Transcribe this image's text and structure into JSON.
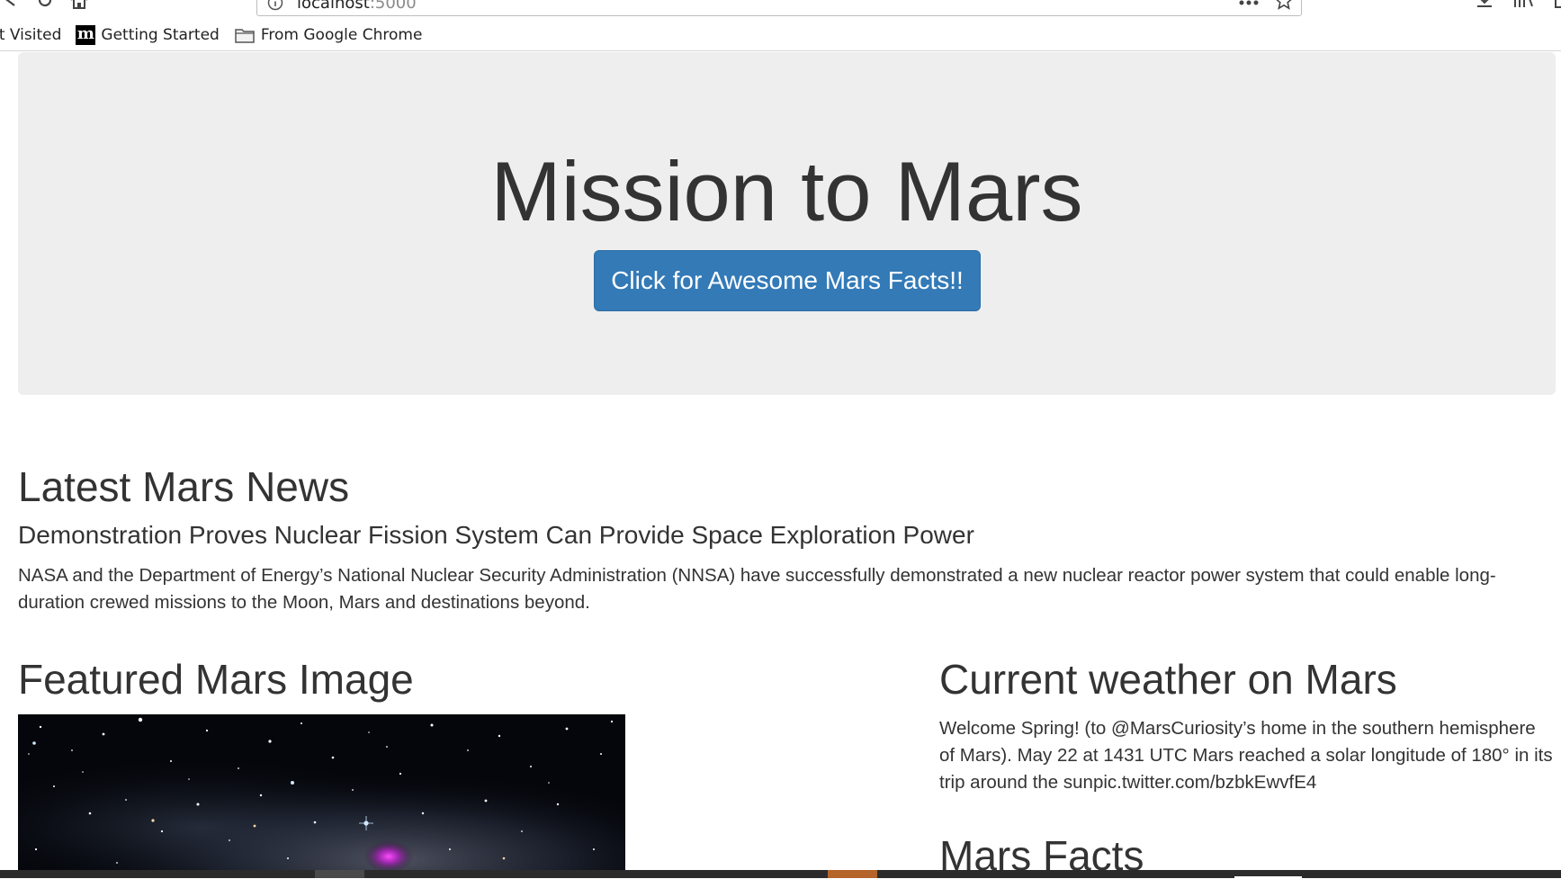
{
  "browser": {
    "url_host": "localhost",
    "url_port": ":5000",
    "bookmarks": [
      {
        "label": "st Visited",
        "icon": "bookmark-icon"
      },
      {
        "label": "Getting Started",
        "icon": "m-logo-icon"
      },
      {
        "label": "From Google Chrome",
        "icon": "folder-icon"
      }
    ],
    "icons": [
      "back-icon",
      "reload-icon",
      "home-icon",
      "info-icon",
      "more-icon",
      "star-icon",
      "download-icon",
      "library-icon"
    ]
  },
  "jumbotron": {
    "title": "Mission to Mars",
    "button_label": "Click for Awesome Mars Facts!!"
  },
  "news": {
    "heading": "Latest Mars News",
    "title": "Demonstration Proves Nuclear Fission System Can Provide Space Exploration Power",
    "paragraph": "NASA and the Department of Energy’s National Nuclear Security Administration (NNSA) have successfully demonstrated a new nuclear reactor power system that could enable long-duration crewed missions to the Moon, Mars and destinations beyond."
  },
  "featured_image": {
    "heading": "Featured Mars Image",
    "image_alt": "space-nebula"
  },
  "weather": {
    "heading": "Current weather on Mars",
    "text": "Welcome Spring! (to @MarsCuriosity’s home in the southern hemisphere of Mars). May 22 at 1431 UTC Mars reached a solar longitude of 180° in its trip around the sunpic.twitter.com/bzbkEwvfE4"
  },
  "facts": {
    "heading": "Mars Facts"
  },
  "colors": {
    "button_bg": "#337ab7",
    "jumbotron_bg": "#eeeeee",
    "text": "#333333"
  }
}
